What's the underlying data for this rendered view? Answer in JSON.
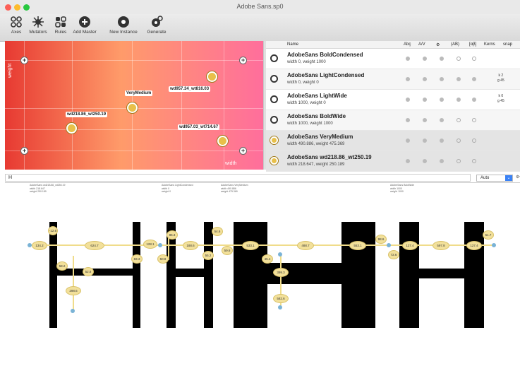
{
  "window": {
    "title": "Adobe Sans.sp0"
  },
  "toolbar": {
    "items": [
      {
        "label": "Axes",
        "icon": "axes-icon"
      },
      {
        "label": "Mutators",
        "icon": "mutators-icon"
      },
      {
        "label": "Rules",
        "icon": "rules-icon"
      },
      {
        "label": "Add Master",
        "icon": "add-master-icon"
      },
      {
        "label": "New Instance",
        "icon": "new-instance-icon"
      },
      {
        "label": "Generate",
        "icon": "generate-icon"
      }
    ]
  },
  "design_space": {
    "axis_y_label": "weight",
    "axis_x_label": "width",
    "instance_labels": [
      "VeryMedium",
      "wd957.34_wt816.03",
      "wd218.86_wt250.19",
      "wd957.03_wt714.67"
    ]
  },
  "masters_list": {
    "headers": [
      "Name",
      "Abç",
      "A/V",
      "⚙",
      "(AB)",
      "[αβ]",
      "Kerns",
      "snap"
    ],
    "rows": [
      {
        "name": "AdobeSans BoldCondensed",
        "location": "width 0, weight 1000",
        "type": "master"
      },
      {
        "name": "AdobeSans LightCondensed",
        "location": "width 0, weight 0",
        "type": "master",
        "extra": [
          "k 2",
          "g 45"
        ]
      },
      {
        "name": "AdobeSans LightWide",
        "location": "width 1000, weight 0",
        "type": "master",
        "extra": [
          "k 0",
          "g 45"
        ]
      },
      {
        "name": "AdobeSans BoldWide",
        "location": "width 1000, weight 1000",
        "type": "master"
      },
      {
        "name": "AdobeSans VeryMedium",
        "location": "width 490.886, weight 475.369",
        "type": "instance"
      },
      {
        "name": "AdobeSans wd218.86_wt250.19",
        "location": "width 218.647, weight 250.189",
        "type": "instance"
      }
    ]
  },
  "preview": {
    "text_value": "H",
    "size_select": "Auto",
    "size_arrow": "⌄",
    "menu_icon": "⚙▾",
    "meta": [
      [
        "AdobeSans wd218.86_wt250.19",
        "width 218.647",
        "weight 250.189"
      ],
      [
        "AdobeSans LightCondensed",
        "width 0",
        "weight 0"
      ],
      [
        "AdobeSans VeryMedium",
        "width 490.886",
        "weight 475.369"
      ],
      [
        "AdobeSans BoldWide",
        "width 1000",
        "weight 1000"
      ]
    ],
    "measure_labels": [
      "-12.6",
      "134.2",
      "624.7",
      "58.2",
      "52.8",
      "298.6",
      "83.3",
      "128.1",
      "50.8",
      "86.3",
      "188.6",
      "55.2",
      "54.6",
      "59.6",
      "533.1",
      "45.4",
      "488.7",
      "399.3",
      "582.6",
      "553.1",
      "98.6",
      "72.6",
      "127.4",
      "597.8",
      "127.4",
      "51.7"
    ]
  }
}
